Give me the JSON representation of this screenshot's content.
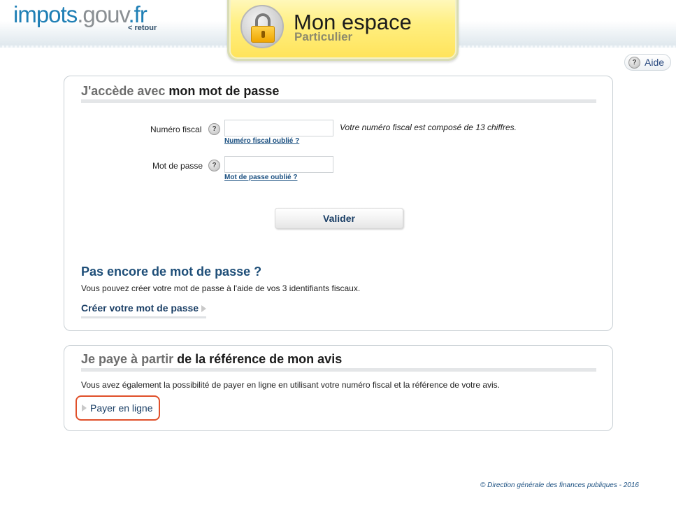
{
  "header": {
    "logo": {
      "part1": "impots",
      "part2": ".gouv",
      "part3": ".fr"
    },
    "back_link": "< retour",
    "tab": {
      "title": "Mon espace",
      "subtitle": "Particulier",
      "icon": "padlock-icon"
    }
  },
  "help": {
    "label": "Aide",
    "icon_glyph": "?"
  },
  "login_panel": {
    "title_grey": "J'accède avec",
    "title_dark": "mon mot de passe",
    "fiscal_number": {
      "label": "Numéro fiscal",
      "help_glyph": "?",
      "value": "",
      "hint": "Votre numéro fiscal est composé de 13 chiffres.",
      "forgot_link": "Numéro fiscal oublié ?"
    },
    "password": {
      "label": "Mot de passe",
      "help_glyph": "?",
      "value": "",
      "forgot_link": "Mot de passe oublié ?"
    },
    "submit_label": "Valider",
    "no_password": {
      "heading": "Pas encore de mot de passe ?",
      "text": "Vous pouvez créer votre mot de passe à l'aide de vos 3 identifiants fiscaux.",
      "create_link": "Créer votre mot de passe"
    }
  },
  "pay_panel": {
    "title_grey": "Je paye à partir",
    "title_dark": "de la référence de mon avis",
    "text": "Vous avez également la possibilité de payer en ligne en utilisant votre numéro fiscal et la référence de votre avis.",
    "pay_link": "Payer en ligne"
  },
  "footer": {
    "copyright": "© Direction générale des finances publiques - 2016"
  },
  "colors": {
    "brand_blue": "#1f7fb5",
    "link_blue": "#1b3f66",
    "heading_blue": "#1e4e78",
    "tab_yellow": "#ffe35a",
    "highlight_orange": "#e0502a"
  }
}
